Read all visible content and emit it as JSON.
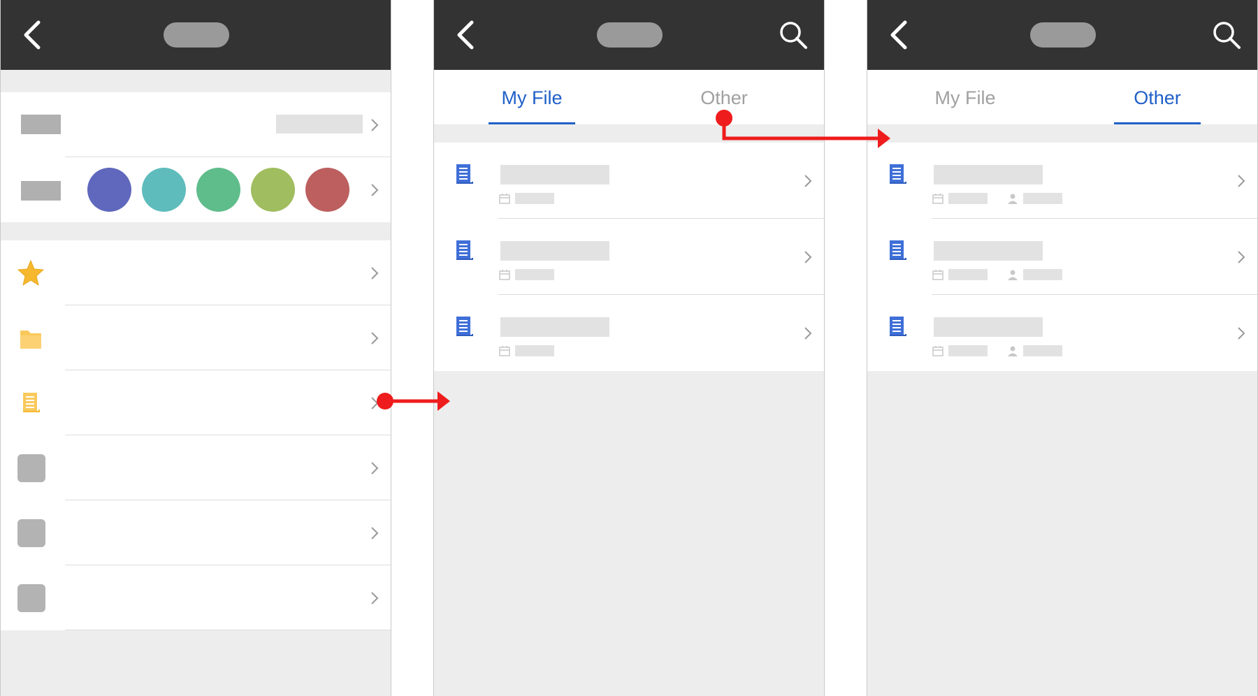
{
  "screens": [
    {
      "id": "settings",
      "color_swatches": [
        "#5f68bd",
        "#5fbcbc",
        "#5fbd8b",
        "#a0bd5f",
        "#bd5f5f"
      ],
      "menu_icons": [
        "star-icon",
        "folder-icon",
        "document-icon",
        "placeholder-icon",
        "placeholder-icon",
        "placeholder-icon"
      ]
    },
    {
      "id": "file-list-my-file",
      "tabs": [
        {
          "label": "My File",
          "active": true
        },
        {
          "label": "Other",
          "active": false
        }
      ],
      "file_rows": 3
    },
    {
      "id": "file-list-other",
      "tabs": [
        {
          "label": "My File",
          "active": false
        },
        {
          "label": "Other",
          "active": true
        }
      ],
      "file_rows": 3
    }
  ],
  "colors": {
    "header": "#333333",
    "accent_blue": "#2060c8",
    "arrow_red": "#ee1c1c",
    "star_yellow": "#f5b82e",
    "folder_yellow": "#f9c95c"
  },
  "labels": {
    "tab_my_file": "My File",
    "tab_other": "Other"
  }
}
